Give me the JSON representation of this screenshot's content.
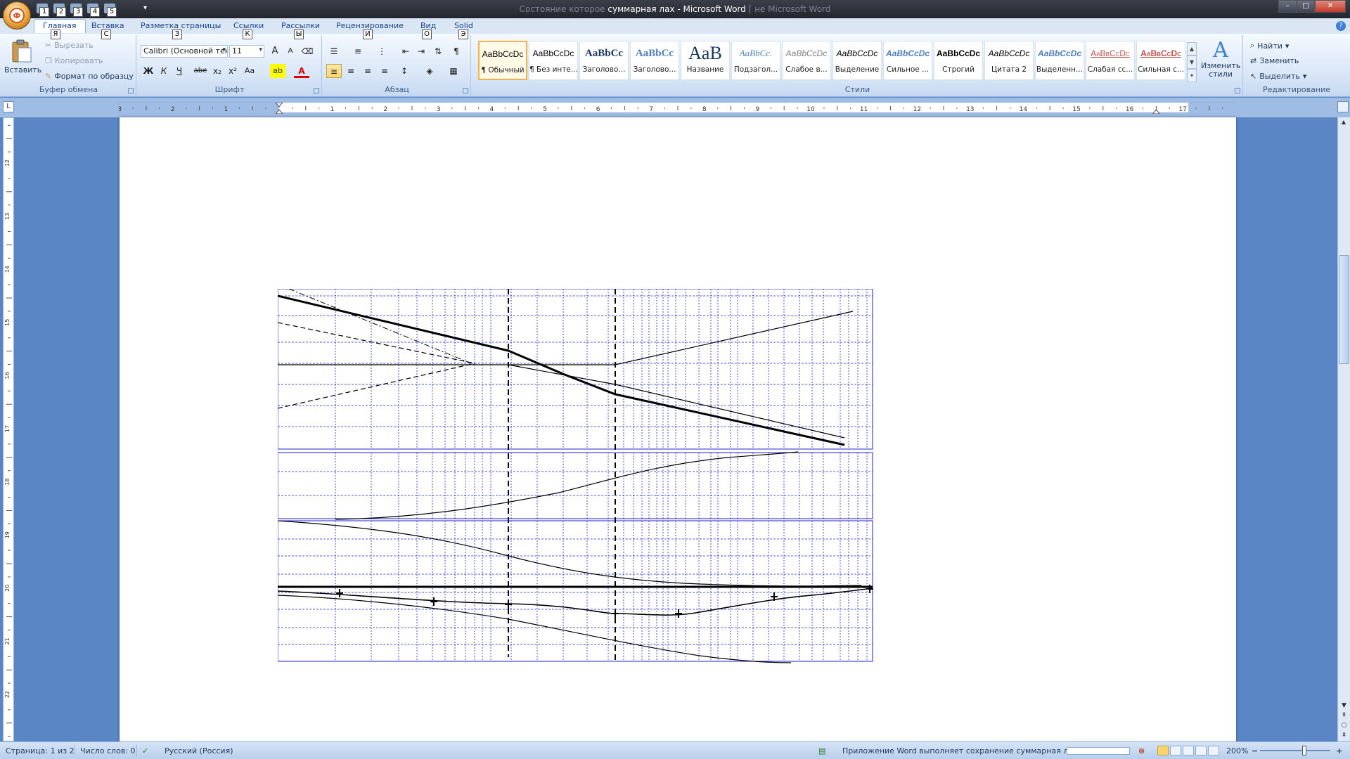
{
  "window": {
    "title_blur_left": "Состояние которое",
    "title": "суммарная лах - Microsoft Word",
    "title_blur_right": "[ не Microsoft Word",
    "minimize": "–",
    "maximize": "□",
    "close": "✕"
  },
  "office_button": {
    "key": "Ф"
  },
  "qat": {
    "keys": [
      "1",
      "2",
      "3",
      "4",
      "5"
    ],
    "more": "▾"
  },
  "tabs": [
    {
      "label": "Главная",
      "key": "Я",
      "active": true
    },
    {
      "label": "Вставка",
      "key": "С"
    },
    {
      "label": "Разметка страницы",
      "key": "З"
    },
    {
      "label": "Ссылки",
      "key": "К"
    },
    {
      "label": "Рассылки",
      "key": "Ы"
    },
    {
      "label": "Рецензирование",
      "key": "И"
    },
    {
      "label": "Вид",
      "key": "О"
    },
    {
      "label": "Solid",
      "key": "Э"
    }
  ],
  "clipboard": {
    "label": "Буфер обмена",
    "paste": "Вставить",
    "cut": "Вырезать",
    "copy": "Копировать",
    "format_painter": "Формат по образцу"
  },
  "font": {
    "label": "Шрифт",
    "family": "Calibri (Основной текст)",
    "size": "11",
    "grow": "A",
    "shrink": "A",
    "bold": "Ж",
    "italic": "К",
    "underline": "Ч",
    "strike": "abe",
    "subscript": "x₂",
    "superscript": "x²",
    "case": "Aa",
    "highlight": "ab",
    "color": "A"
  },
  "paragraph": {
    "label": "Абзац"
  },
  "styles": {
    "label": "Стили",
    "items": [
      {
        "sample": "AaBbCcDc",
        "name": "¶ Обычный",
        "selected": true
      },
      {
        "sample": "AaBbCcDc",
        "name": "¶ Без инте..."
      },
      {
        "sample": "AaBbCc",
        "name": "Заголово..."
      },
      {
        "sample": "AaBbCc",
        "name": "Заголово..."
      },
      {
        "sample": "AaB",
        "name": "Название"
      },
      {
        "sample": "AaBbCc.",
        "name": "Подзагол..."
      },
      {
        "sample": "AaBbCcDc",
        "name": "Слабое в..."
      },
      {
        "sample": "AaBbCcDc",
        "name": "Выделение"
      },
      {
        "sample": "AaBbCcDc",
        "name": "Сильное ..."
      },
      {
        "sample": "AaBbCcDc",
        "name": "Строгий"
      },
      {
        "sample": "AaBbCcDc",
        "name": "Цитата 2"
      },
      {
        "sample": "AaBbCcDc",
        "name": "Выделенн..."
      },
      {
        "sample": "AaBbCcDc",
        "name": "Слабая сс..."
      },
      {
        "sample": "AaBbCcDc",
        "name": "Сильная с..."
      }
    ],
    "change_styles": "Изменить стили"
  },
  "editing": {
    "label": "Редактирование",
    "find": "Найти",
    "replace": "Заменить",
    "select": "Выделить"
  },
  "ruler": {
    "left_labels": [
      "3",
      "2",
      "1"
    ],
    "right_labels": [
      "1",
      "2",
      "3",
      "4",
      "5",
      "6",
      "7",
      "8",
      "9",
      "10",
      "11",
      "12",
      "13",
      "14",
      "15",
      "16",
      "17"
    ],
    "vertical_labels": [
      "12",
      "13",
      "14",
      "15",
      "16",
      "17",
      "18",
      "19",
      "20",
      "21",
      "22"
    ]
  },
  "status": {
    "page": "Страница: 1 из 2",
    "words": "Число слов: 0",
    "language": "Русский (Россия)",
    "saving": "Приложение Word выполняет сохранение суммарная лах:",
    "save_progress": 0,
    "zoom": "200%",
    "zoom_minus": "−",
    "zoom_plus": "+"
  },
  "colors": {
    "grid": "#2222cc",
    "curve": "#000000",
    "ribbon_text": "#15428b"
  }
}
